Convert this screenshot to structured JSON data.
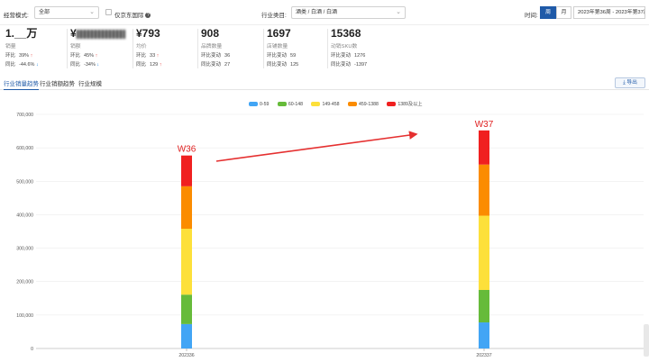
{
  "filters": {
    "mode_label": "经营模式:",
    "mode_value": "全部",
    "jd_intl_label": "仅京东国际",
    "category_label": "行业类目:",
    "category_value": "酒类 / 白酒 / 白酒",
    "time_label": "时间:",
    "period_week": "周",
    "period_month": "月",
    "date_range": "2023年第36周 - 2023年第37周"
  },
  "metrics": [
    {
      "value": "1.__万",
      "name": "销量",
      "r1_label": "环比",
      "r1_value": "39%",
      "r1_dir": "up",
      "r2_label": "同比",
      "r2_value": "-44.6%",
      "r2_dir": "down"
    },
    {
      "value": "¥",
      "name": "销额",
      "r1_label": "环比",
      "r1_value": "45%",
      "r1_dir": "up",
      "r2_label": "同比",
      "r2_value": "-34%",
      "r2_dir": "down"
    },
    {
      "value": "¥793",
      "name": "均价",
      "r1_label": "环比",
      "r1_value": "33",
      "r1_dir": "up",
      "r2_label": "同比",
      "r2_value": "129",
      "r2_dir": "up"
    },
    {
      "value": "908",
      "name": "品牌数量",
      "r1_label": "环比变动",
      "r1_value": "36",
      "r1_dir": "",
      "r2_label": "同比变动",
      "r2_value": "27",
      "r2_dir": ""
    },
    {
      "value": "1697",
      "name": "店铺数量",
      "r1_label": "环比变动",
      "r1_value": "59",
      "r1_dir": "",
      "r2_label": "同比变动",
      "r2_value": "125",
      "r2_dir": ""
    },
    {
      "value": "15368",
      "name": "动销SKU数",
      "r1_label": "环比变动",
      "r1_value": "1276",
      "r1_dir": "",
      "r2_label": "同比变动",
      "r2_value": "-1397",
      "r2_dir": ""
    }
  ],
  "tabs": [
    {
      "label": "行业销量趋势",
      "active": true
    },
    {
      "label": "行业销额趋势",
      "active": false
    },
    {
      "label": "行业规模",
      "active": false
    }
  ],
  "export_label": "导出",
  "chart_data": {
    "type": "bar",
    "stacked": true,
    "categories": [
      "202336",
      "202337"
    ],
    "series": [
      {
        "name": "0-59",
        "color": "#42a5f5",
        "values": [
          73000,
          78000
        ]
      },
      {
        "name": "60-148",
        "color": "#66bb3a",
        "values": [
          88000,
          97000
        ]
      },
      {
        "name": "149-458",
        "color": "#fde03a",
        "values": [
          197000,
          222000
        ]
      },
      {
        "name": "459-1388",
        "color": "#fb8c00",
        "values": [
          127000,
          153000
        ]
      },
      {
        "name": "1389及以上",
        "color": "#f02020",
        "values": [
          92000,
          102000
        ]
      }
    ],
    "ylim": [
      0,
      700000
    ],
    "yticks": [
      "0",
      "100,000",
      "200,000",
      "300,000",
      "400,000",
      "500,000",
      "600,000",
      "700,000"
    ],
    "grid": true,
    "legend": "top-center",
    "annotations": [
      {
        "text": "W36",
        "category": "202336",
        "color": "#e02020"
      },
      {
        "text": "W37",
        "category": "202337",
        "color": "#e02020"
      }
    ],
    "arrow_color": "#e53030"
  }
}
